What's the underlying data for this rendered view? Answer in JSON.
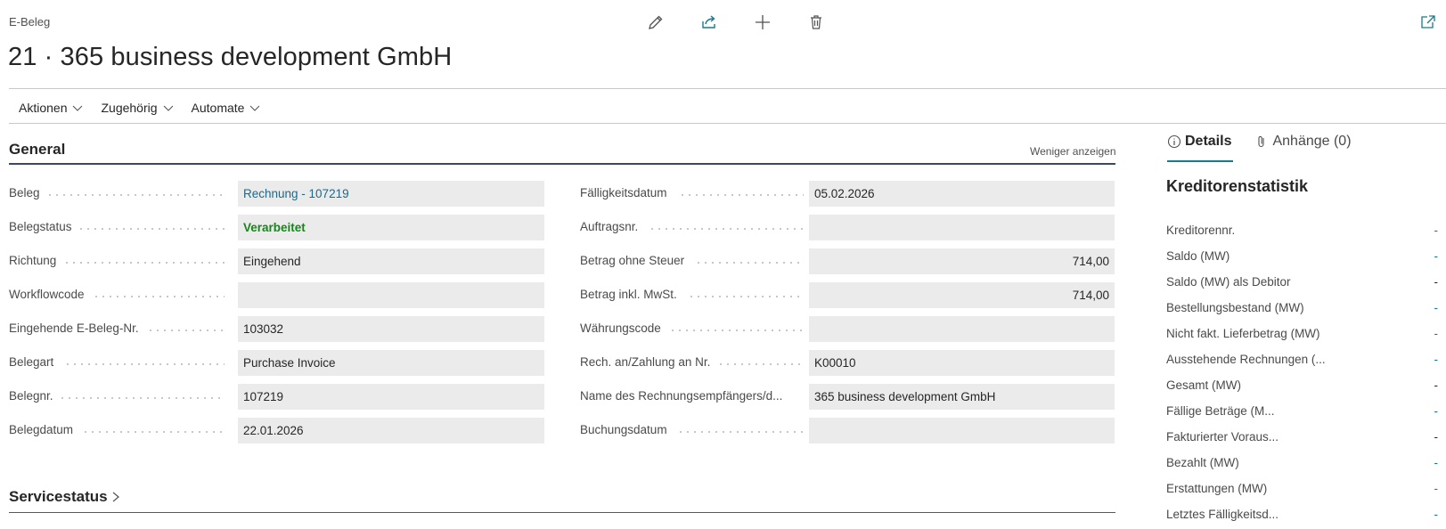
{
  "header": {
    "breadcrumb": "E-Beleg",
    "title": "21 · 365 business development GmbH"
  },
  "toolbar": {
    "icons": [
      "edit-icon",
      "share-icon",
      "new-icon",
      "delete-icon"
    ],
    "popout_icon": "open-new-window-icon"
  },
  "menu": {
    "items": [
      {
        "label": "Aktionen"
      },
      {
        "label": "Zugehörig"
      },
      {
        "label": "Automate"
      }
    ]
  },
  "general": {
    "title": "General",
    "toggle_label": "Weniger anzeigen",
    "left_fields": [
      {
        "label": "Beleg",
        "value": "Rechnung - 107219",
        "style": "link"
      },
      {
        "label": "Belegstatus",
        "value": "Verarbeitet",
        "style": "ok"
      },
      {
        "label": "Richtung",
        "value": "Eingehend",
        "style": ""
      },
      {
        "label": "Workflowcode",
        "value": "",
        "style": ""
      },
      {
        "label": "Eingehende E-Beleg-Nr.",
        "value": "103032",
        "style": ""
      },
      {
        "label": "Belegart",
        "value": "Purchase Invoice",
        "style": ""
      },
      {
        "label": "Belegnr.",
        "value": "107219",
        "style": ""
      },
      {
        "label": "Belegdatum",
        "value": "22.01.2026",
        "style": ""
      }
    ],
    "right_fields": [
      {
        "label": "Fälligkeitsdatum",
        "value": "05.02.2026",
        "align": "left"
      },
      {
        "label": "Auftragsnr.",
        "value": "",
        "align": "left"
      },
      {
        "label": "Betrag ohne Steuer",
        "value": "714,00",
        "align": "right"
      },
      {
        "label": "Betrag inkl. MwSt.",
        "value": "714,00",
        "align": "right"
      },
      {
        "label": "Währungscode",
        "value": "",
        "align": "left"
      },
      {
        "label": "Rech. an/Zahlung an Nr.",
        "value": "K00010",
        "align": "left"
      },
      {
        "label": "Name des Rechnungsempfängers/d...",
        "value": "365 business development GmbH",
        "align": "left"
      },
      {
        "label": "Buchungsdatum",
        "value": "",
        "align": "left"
      }
    ]
  },
  "service_status": {
    "title": "Servicestatus"
  },
  "factbox": {
    "tabs": [
      {
        "label": "Details",
        "icon": "info-icon"
      },
      {
        "label": "Anhänge (0)",
        "icon": "paperclip-icon"
      }
    ],
    "title": "Kreditorenstatistik",
    "rows": [
      {
        "label": "Kreditorennr.",
        "value": "-",
        "link": true
      },
      {
        "label": "Saldo (MW)",
        "value": "-",
        "link": true
      },
      {
        "label": "Saldo (MW) als Debitor",
        "value": "-",
        "link": false
      },
      {
        "label": "Bestellungsbestand (MW)",
        "value": "-",
        "link": true
      },
      {
        "label": "Nicht fakt. Lieferbetrag (MW)",
        "value": "-",
        "link": true
      },
      {
        "label": "Ausstehende Rechnungen (...",
        "value": "-",
        "link": true
      },
      {
        "label": "Gesamt (MW)",
        "value": "-",
        "link": false
      },
      {
        "label": "Fällige Beträge (M...",
        "value": "-",
        "link": true
      },
      {
        "label": "Fakturierter Voraus...",
        "value": "-",
        "link": false
      },
      {
        "label": "Bezahlt (MW)",
        "value": "-",
        "link": true
      },
      {
        "label": "Erstattungen (MW)",
        "value": "-",
        "link": true
      },
      {
        "label": "Letztes Fälligkeitsd...",
        "value": "-",
        "link": true
      }
    ]
  },
  "colors": {
    "accent": "#1a7a8a",
    "status_ok": "#17851c",
    "field_bg": "#ebebec"
  }
}
